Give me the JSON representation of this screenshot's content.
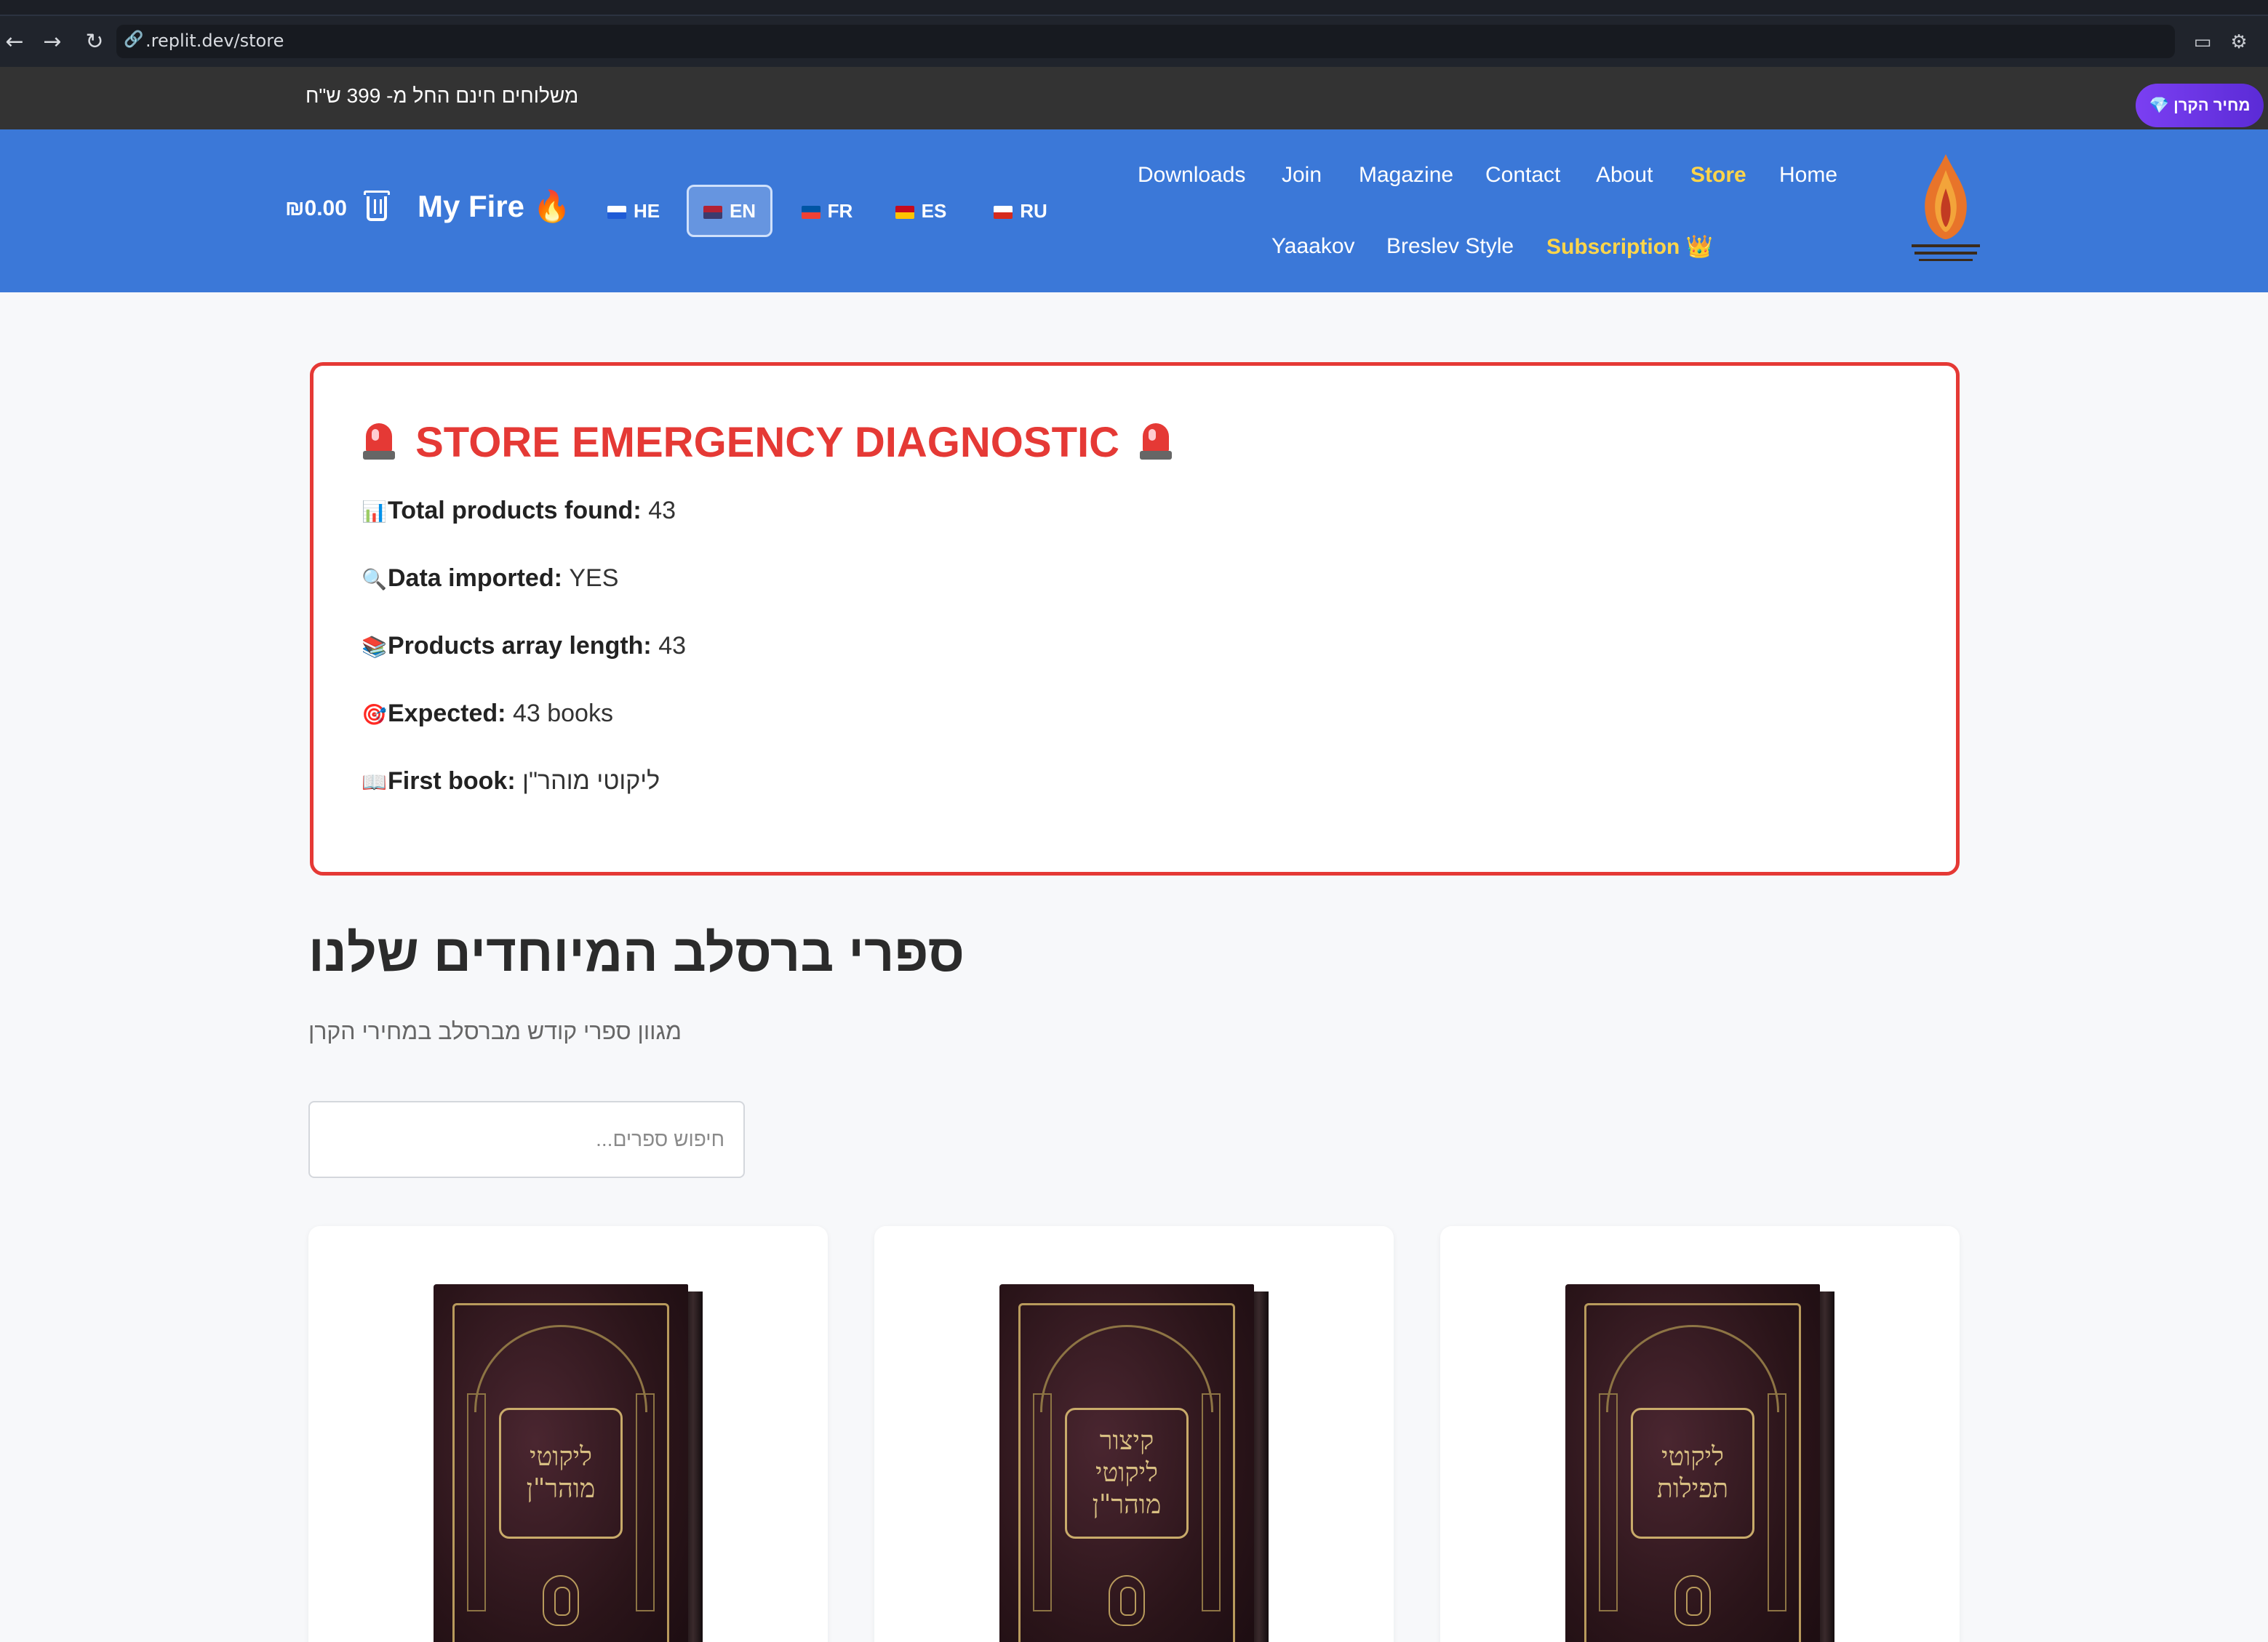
{
  "browser": {
    "url": ".replit.dev/store",
    "back_icon": "←",
    "forward_icon": "→",
    "reload_icon": "↻",
    "link_icon": "🔗"
  },
  "announcement": {
    "text": "משלוחים חינם החל מ- 399 ש\"ח",
    "price_button": "💎 מחיר הקרן"
  },
  "header": {
    "cart_total": "₪0.00",
    "my_fire": "My Fire 🔥",
    "languages": [
      {
        "code": "HE",
        "flag_colors": [
          "#ffffff",
          "#1f5bd6"
        ]
      },
      {
        "code": "EN",
        "flag_colors": [
          "#b22234",
          "#3c3b6e"
        ],
        "active": true
      },
      {
        "code": "FR",
        "flag_colors": [
          "#0055a4",
          "#ef4135"
        ]
      },
      {
        "code": "ES",
        "flag_colors": [
          "#c60b1e",
          "#ffc400"
        ]
      },
      {
        "code": "RU",
        "flag_colors": [
          "#ffffff",
          "#d52b1e"
        ]
      }
    ],
    "nav_row1": [
      "Downloads",
      "Join",
      "Magazine",
      "Contact",
      "About",
      "Store",
      "Home"
    ],
    "nav_row2": [
      "Yaaakov",
      "Breslev Style",
      "Subscription 👑"
    ],
    "accent_color": "#ffd54a",
    "bg_color": "#3b78d8"
  },
  "diagnostic": {
    "title": "STORE EMERGENCY DIAGNOSTIC",
    "rows": [
      {
        "icon": "📊",
        "label": "Total products found:",
        "value": "43"
      },
      {
        "icon": "🔍",
        "label": "Data imported:",
        "value": "YES"
      },
      {
        "icon": "📚",
        "label": "Products array length:",
        "value": "43"
      },
      {
        "icon": "🎯",
        "label": "Expected:",
        "value": "43 books"
      },
      {
        "icon": "📖",
        "label": "First book:",
        "value": "ליקוטי מוהר\"ן"
      }
    ],
    "border_color": "#e53935"
  },
  "store": {
    "title": "ספרי ברסלב המיוחדים שלנו",
    "subtitle": "מגוון ספרי קודש מברסלב במחירי הקרן",
    "search_placeholder": "חיפוש ספרים...",
    "products": [
      {
        "cover_text": "ליקוטי מוהר\"ן"
      },
      {
        "cover_text": "קיצור ליקוטי מוהר\"ן"
      },
      {
        "cover_text": "ליקוטי תפילות"
      }
    ]
  }
}
